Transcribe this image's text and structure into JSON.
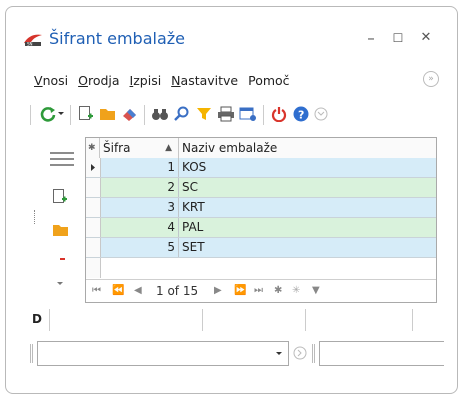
{
  "window": {
    "title": "Šifrant embalaže",
    "minimize": "–",
    "maximize": "☐",
    "close": "✕"
  },
  "menu": {
    "items": [
      {
        "accel": "V",
        "rest": "nosi"
      },
      {
        "accel": "O",
        "rest": "rodja"
      },
      {
        "accel": "I",
        "rest": "zpisi"
      },
      {
        "accel": "N",
        "rest": "astavitve"
      },
      {
        "accel": "",
        "rest": "Pomoč"
      }
    ]
  },
  "toolbar": {
    "icons": [
      "refresh-icon",
      "dropdown-arrow-icon",
      "new-record-icon",
      "open-folder-icon",
      "eraser-icon",
      "binoculars-icon",
      "search-icon",
      "filter-icon",
      "print-icon",
      "table-settings-icon",
      "power-icon",
      "help-icon",
      "chevron-icon"
    ]
  },
  "colors": {
    "row_blue": "#d6ecf8",
    "row_green": "#d9f2dc",
    "title_blue": "#1f5fb4"
  },
  "grid": {
    "header": {
      "sifra": "Šifra",
      "naziv": "Naziv embalaže",
      "star": "✱",
      "sort": "▲"
    },
    "rows": [
      {
        "sifra": "1",
        "naziv": "KOS"
      },
      {
        "sifra": "2",
        "naziv": "SC"
      },
      {
        "sifra": "3",
        "naziv": "KRT"
      },
      {
        "sifra": "4",
        "naziv": "PAL"
      },
      {
        "sifra": "5",
        "naziv": "SET"
      }
    ],
    "navigator": {
      "position": "1 of 15"
    }
  },
  "bottom": {
    "label": "D"
  }
}
